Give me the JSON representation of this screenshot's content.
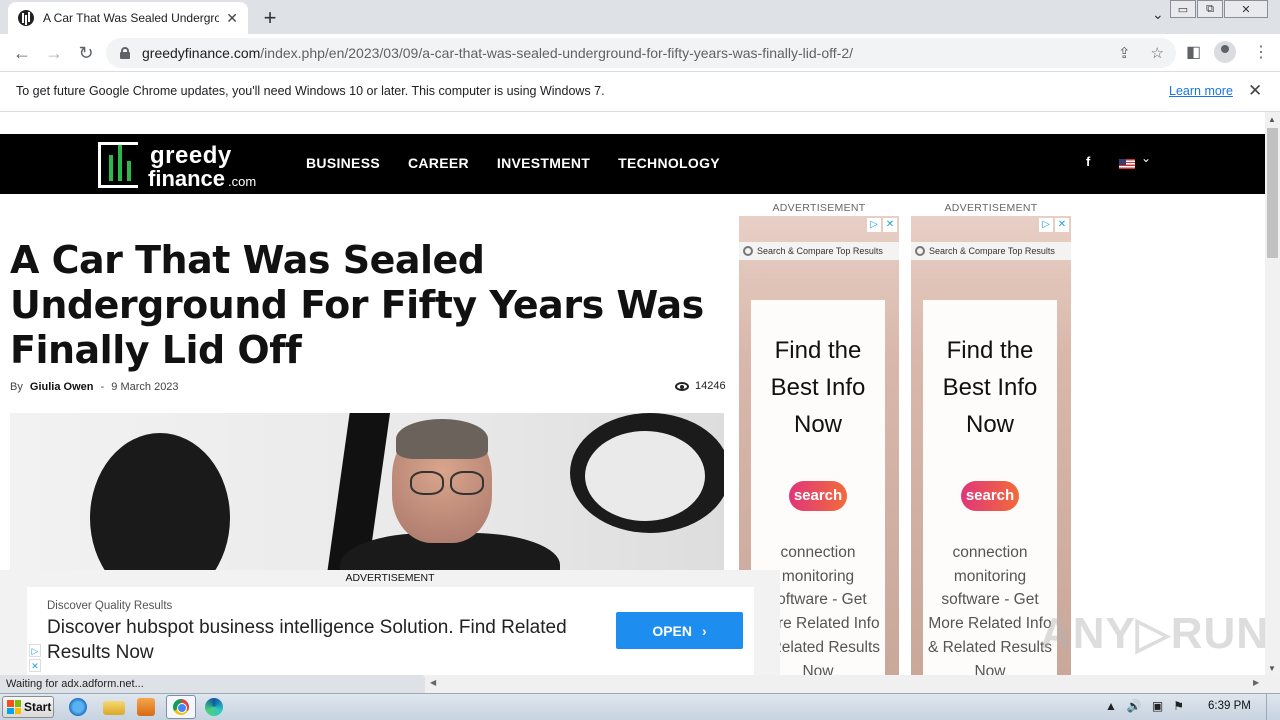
{
  "browser": {
    "tab_title": "A Car That Was Sealed Underground For Fifty Years Was Finally Lid Off",
    "tab_close": "✕",
    "new_tab": "+",
    "url_host": "greedyfinance.com",
    "url_path": "/index.php/en/2023/03/09/a-car-that-was-sealed-underground-for-fifty-years-was-finally-lid-off-2/",
    "window_buttons": {
      "minimize": "▭",
      "restore": "⧉",
      "close": "✕"
    },
    "nav": {
      "back": "←",
      "forward": "→",
      "reload": "↻"
    },
    "icons": {
      "share": "⇪",
      "star": "☆",
      "sidepanel": "◧",
      "menu": "⋮",
      "tab_search": "⌄"
    }
  },
  "infobar": {
    "message": "To get future Google Chrome updates, you'll need Windows 10 or later. This computer is using Windows 7.",
    "link": "Learn more",
    "close": "✕"
  },
  "site": {
    "logo_line1": "greedy",
    "logo_line2": "finance",
    "logo_suffix": ".com",
    "menu": [
      "BUSINESS",
      "CAREER",
      "INVESTMENT",
      "TECHNOLOGY"
    ],
    "facebook": "f",
    "flag_chevron": "⌄"
  },
  "article": {
    "headline": "A Car That Was Sealed Underground For Fifty Years Was Finally Lid Off",
    "by": "By",
    "author": "Giulia Owen",
    "separator": "-",
    "date": "9 March 2023",
    "views": "14246"
  },
  "side_ads": [
    {
      "label": "ADVERTISEMENT",
      "search_bar": "Search & Compare Top Results",
      "title": "Find the Best Info Now",
      "pill": "search",
      "body": "connection monitoring software - Get More Related Info & Related Results Now"
    },
    {
      "label": "ADVERTISEMENT",
      "search_bar": "Search & Compare Top Results",
      "title": "Find the Best Info Now",
      "pill": "search",
      "body": "connection monitoring software - Get More Related Info & Related Results Now"
    }
  ],
  "bottom_ad": {
    "label": "ADVERTISEMENT",
    "sub": "Discover Quality Results",
    "main": "Discover hubspot business intelligence Solution. Find Related Results Now",
    "button": "OPEN",
    "button_chevron": "›"
  },
  "status": {
    "text": "Waiting for adx.adform.net..."
  },
  "taskbar": {
    "start": "Start",
    "time": "6:39 PM",
    "tray_icons": [
      "▲",
      "🔊",
      "▣",
      "⚑"
    ]
  },
  "watermark": "ANY▷RUN"
}
